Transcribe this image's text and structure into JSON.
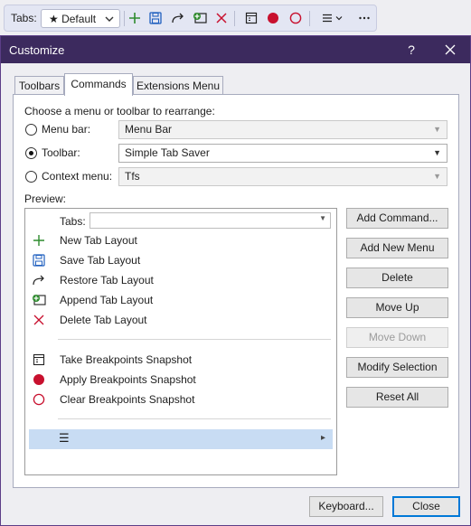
{
  "toolbar": {
    "tabs_label": "Tabs:",
    "default_value": "★ Default",
    "icons": [
      "plus-icon",
      "save-icon",
      "restore-arrow-icon",
      "append-layout-icon",
      "delete-x-icon",
      "breakpoints-snapshot-icon",
      "apply-breakpoints-icon",
      "clear-breakpoints-icon",
      "menu-icon",
      "more-icon"
    ]
  },
  "dialog": {
    "title": "Customize",
    "help": "?",
    "tabs": [
      {
        "label": "Toolbars"
      },
      {
        "label": "Commands"
      },
      {
        "label": "Extensions Menu"
      }
    ],
    "choose_label": "Choose a menu or toolbar to rearrange:",
    "options": [
      {
        "label": "Menu bar:",
        "value": "Menu Bar"
      },
      {
        "label": "Toolbar:",
        "value": "Simple Tab Saver"
      },
      {
        "label": "Context menu:",
        "value": "Tfs"
      }
    ],
    "preview_label": "Preview:",
    "preview": {
      "tabs_label": "Tabs:",
      "items": [
        {
          "label": "New Tab Layout"
        },
        {
          "label": "Save Tab Layout"
        },
        {
          "label": "Restore Tab Layout"
        },
        {
          "label": "Append Tab Layout"
        },
        {
          "label": "Delete Tab Layout"
        },
        {
          "label": "Take Breakpoints Snapshot"
        },
        {
          "label": "Apply Breakpoints Snapshot"
        },
        {
          "label": "Clear Breakpoints Snapshot"
        }
      ],
      "menu_glyph": "☰",
      "submenu_arrow": "▸"
    },
    "buttons": {
      "add_command": "Add Command...",
      "add_new_menu": "Add New Menu",
      "delete": "Delete",
      "move_up": "Move Up",
      "move_down": "Move Down",
      "modify_selection": "Modify Selection",
      "reset_all": "Reset All",
      "keyboard": "Keyboard...",
      "close": "Close"
    },
    "colors": {
      "title_bar": "#3c2a5e",
      "accent_red": "#c8102e",
      "accent_green": "#2e8b2e",
      "accent_blue": "#1f5fbf"
    }
  }
}
